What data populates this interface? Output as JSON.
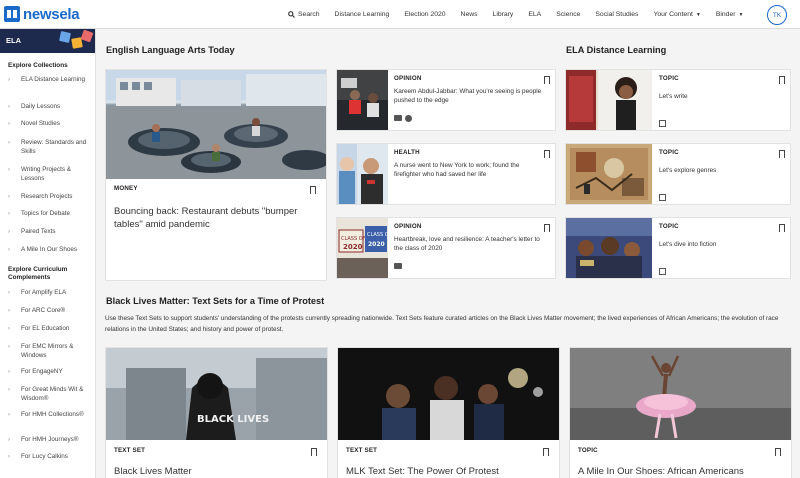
{
  "header": {
    "logo_text": "newsela",
    "search_label": "Search",
    "nav": [
      "Distance Learning",
      "Election 2020",
      "News",
      "Library",
      "ELA",
      "Science",
      "Social Studies"
    ],
    "dropdowns": [
      "Your Content",
      "Binder"
    ],
    "avatar_initials": "TK"
  },
  "sidebar": {
    "banner": "ELA",
    "explore_collections_heading": "Explore Collections",
    "collections": [
      "ELA Distance Learning",
      "Daily Lessons",
      "Novel Studies",
      "Review: Standards and Skills",
      "Writing Projects & Lessons",
      "Research Projects",
      "Topics for Debate",
      "Paired Texts",
      "A Mile In Our Shoes"
    ],
    "explore_complements_heading": "Explore Curriculum Complements",
    "complements": [
      "For Amplify ELA",
      "For ARC Core®",
      "For EL Education",
      "For EMC Mirrors & Windows",
      "For EngageNY",
      "For Great Minds Wit & Wisdom®",
      "For HMH Collections®",
      "For HMH Journeys®",
      "For Lucy Calkins"
    ]
  },
  "ela_today": {
    "title": "English Language Arts Today",
    "feature": {
      "kicker": "MONEY",
      "title": "Bouncing back: Restaurant debuts \"bumper tables\" amid pandemic"
    },
    "items": [
      {
        "kicker": "OPINION",
        "title": "Kareem Abdul-Jabbar: What you're seeing is people pushed to the edge"
      },
      {
        "kicker": "HEALTH",
        "title": "A nurse went to New York to work; found the firefighter who had saved her life"
      },
      {
        "kicker": "OPINION",
        "title": "Heartbreak, love and resilience: A teacher's letter to the class of 2020"
      }
    ]
  },
  "ela_distance": {
    "title": "ELA Distance Learning",
    "items": [
      {
        "kicker": "TOPIC",
        "title": "Let's write"
      },
      {
        "kicker": "TOPIC",
        "title": "Let's explore genres"
      },
      {
        "kicker": "TOPIC",
        "title": "Let's dive into fiction"
      }
    ]
  },
  "blm": {
    "title": "Black Lives Matter: Text Sets for a Time of Protest",
    "description": "Use these Text Sets to support students' understanding of the protests currently spreading nationwide. Text Sets feature curated articles on the Black Lives Matter movement; the lived experiences of African Americans; the evolution of race relations in the United States; and history and power of protest.",
    "hoodie_text": "BLACK LIVES",
    "cards": [
      {
        "kicker": "TEXT SET",
        "title": "Black Lives Matter"
      },
      {
        "kicker": "TEXT SET",
        "title": "MLK Text Set: The Power Of Protest"
      },
      {
        "kicker": "TOPIC",
        "title": "A Mile In Our Shoes: African Americans"
      }
    ]
  },
  "photo_signs": {
    "class_of": "CLASS OF",
    "year": "2020"
  },
  "colors": {
    "brand": "#1b6ac9",
    "banner": "#1d2a4d"
  }
}
